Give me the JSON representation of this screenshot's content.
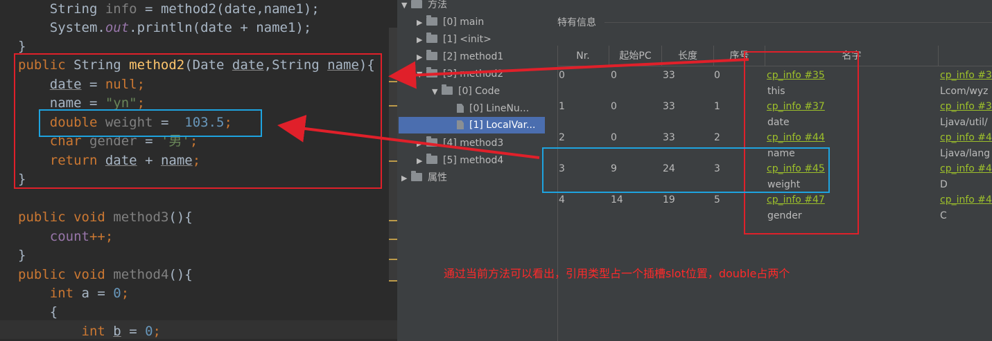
{
  "editor": {
    "lines": [
      {
        "parts": [
          "    String ",
          "info",
          " = ",
          "method2",
          "(date,name1);"
        ]
      },
      {
        "parts": [
          "    System.",
          "out",
          ".println(date + name1);"
        ]
      },
      {
        "parts": [
          "}"
        ]
      },
      {
        "parts": [
          "public",
          " String ",
          "method2",
          "(Date ",
          "date",
          ",String ",
          "name",
          "){"
        ]
      },
      {
        "parts": [
          "    ",
          "date",
          " = ",
          "null",
          ";"
        ]
      },
      {
        "parts": [
          "    name = ",
          "\"yn\"",
          ";"
        ]
      },
      {
        "parts": [
          "    ",
          "double",
          " ",
          "weight",
          " =  ",
          "103.5",
          ";"
        ]
      },
      {
        "parts": [
          "    ",
          "char",
          " ",
          "gender",
          " = ",
          "'男'",
          ";"
        ]
      },
      {
        "parts": [
          "    ",
          "return",
          " ",
          "date",
          " + ",
          "name",
          ";"
        ]
      },
      {
        "parts": [
          "}"
        ]
      },
      {
        "parts": [
          ""
        ]
      },
      {
        "parts": [
          "public",
          " ",
          "void",
          " ",
          "method3",
          "(){"
        ]
      },
      {
        "parts": [
          "    ",
          "count",
          "++;"
        ]
      },
      {
        "parts": [
          "}"
        ]
      },
      {
        "parts": [
          "public",
          " ",
          "void",
          " ",
          "method4",
          "(){"
        ]
      },
      {
        "parts": [
          "    ",
          "int",
          " a = ",
          "0",
          ";"
        ]
      },
      {
        "parts": [
          "    {"
        ]
      },
      {
        "parts": [
          "        ",
          "int",
          " ",
          "b",
          " = ",
          "0",
          ";"
        ]
      }
    ]
  },
  "tree": {
    "root_label": "方法",
    "items": [
      {
        "label": "[0] main"
      },
      {
        "label": "[1] <init>"
      },
      {
        "label": "[2] method1"
      },
      {
        "label": "[3] method2"
      },
      {
        "label": "[0] Code"
      },
      {
        "label": "[0] LineNu..."
      },
      {
        "label": "[1] LocalVar..."
      },
      {
        "label": "[4] method3"
      },
      {
        "label": "[5] method4"
      },
      {
        "label": "属性"
      }
    ]
  },
  "info": {
    "title": "特有信息",
    "columns": [
      "Nr.",
      "起始PC",
      "长度",
      "序号",
      "名字",
      ""
    ],
    "rows": [
      {
        "nr": "0",
        "start_pc": "0",
        "length": "33",
        "index": "0",
        "name_link": "cp_info #35",
        "name": "this",
        "desc_link": "cp_info #3",
        "desc": "Lcom/wyz"
      },
      {
        "nr": "1",
        "start_pc": "0",
        "length": "33",
        "index": "1",
        "name_link": "cp_info #37",
        "name": "date",
        "desc_link": "cp_info #3",
        "desc": "Ljava/util/"
      },
      {
        "nr": "2",
        "start_pc": "0",
        "length": "33",
        "index": "2",
        "name_link": "cp_info #44",
        "name": "name",
        "desc_link": "cp_info #4",
        "desc": "Ljava/lang"
      },
      {
        "nr": "3",
        "start_pc": "9",
        "length": "24",
        "index": "3",
        "name_link": "cp_info #45",
        "name": "weight",
        "desc_link": "cp_info #4",
        "desc": "D"
      },
      {
        "nr": "4",
        "start_pc": "14",
        "length": "19",
        "index": "5",
        "name_link": "cp_info #47",
        "name": "gender",
        "desc_link": "cp_info #4",
        "desc": "C"
      }
    ]
  },
  "annotation": {
    "note": "通过当前方法可以看出，引用类型占一个插槽slot位置，double占两个"
  },
  "colors": {
    "annotation_red": "#e0202a",
    "annotation_blue": "#1ea4e0",
    "link_green": "#9ec12a",
    "selection_blue": "#4b6eaf"
  }
}
